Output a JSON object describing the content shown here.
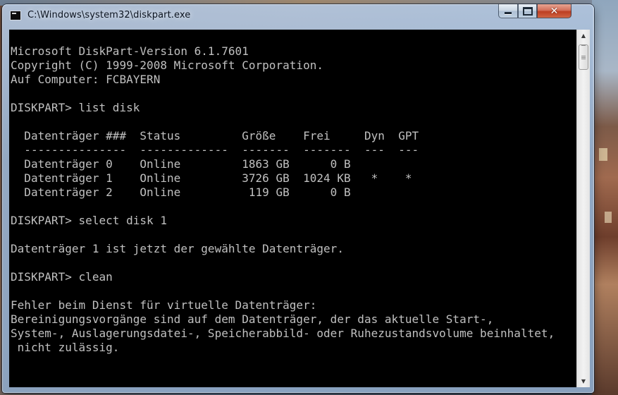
{
  "window": {
    "title": "C:\\Windows\\system32\\diskpart.exe",
    "icons": {
      "app": "console-icon",
      "minimize": "minimize-icon",
      "maximize": "maximize-icon",
      "close": "close-icon"
    },
    "close_glyph": "✕"
  },
  "console": {
    "colors": {
      "background": "#000000",
      "foreground": "#c0c0c0"
    },
    "lines": [
      "Microsoft DiskPart-Version 6.1.7601",
      "Copyright (C) 1999-2008 Microsoft Corporation.",
      "Auf Computer: FCBAYERN",
      "",
      "DISKPART> list disk",
      "",
      "  Datenträger ###  Status         Größe    Frei     Dyn  GPT",
      "  ---------------  -------------  -------  -------  ---  ---",
      "  Datenträger 0    Online         1863 GB      0 B",
      "  Datenträger 1    Online         3726 GB  1024 KB   *    *",
      "  Datenträger 2    Online          119 GB      0 B",
      "",
      "DISKPART> select disk 1",
      "",
      "Datenträger 1 ist jetzt der gewählte Datenträger.",
      "",
      "DISKPART> clean",
      "",
      "Fehler beim Dienst für virtuelle Datenträger:",
      "Bereinigungsvorgänge sind auf dem Datenträger, der das aktuelle Start-,",
      "System-, Auslagerungsdatei-, Speicherabbild- oder Ruhezustandsvolume beinhaltet,",
      " nicht zulässig."
    ]
  },
  "scrollbar": {
    "up_arrow": "▲",
    "down_arrow": "▼",
    "icons": {
      "up": "scroll-up-arrow-icon",
      "down": "scroll-down-arrow-icon"
    }
  }
}
